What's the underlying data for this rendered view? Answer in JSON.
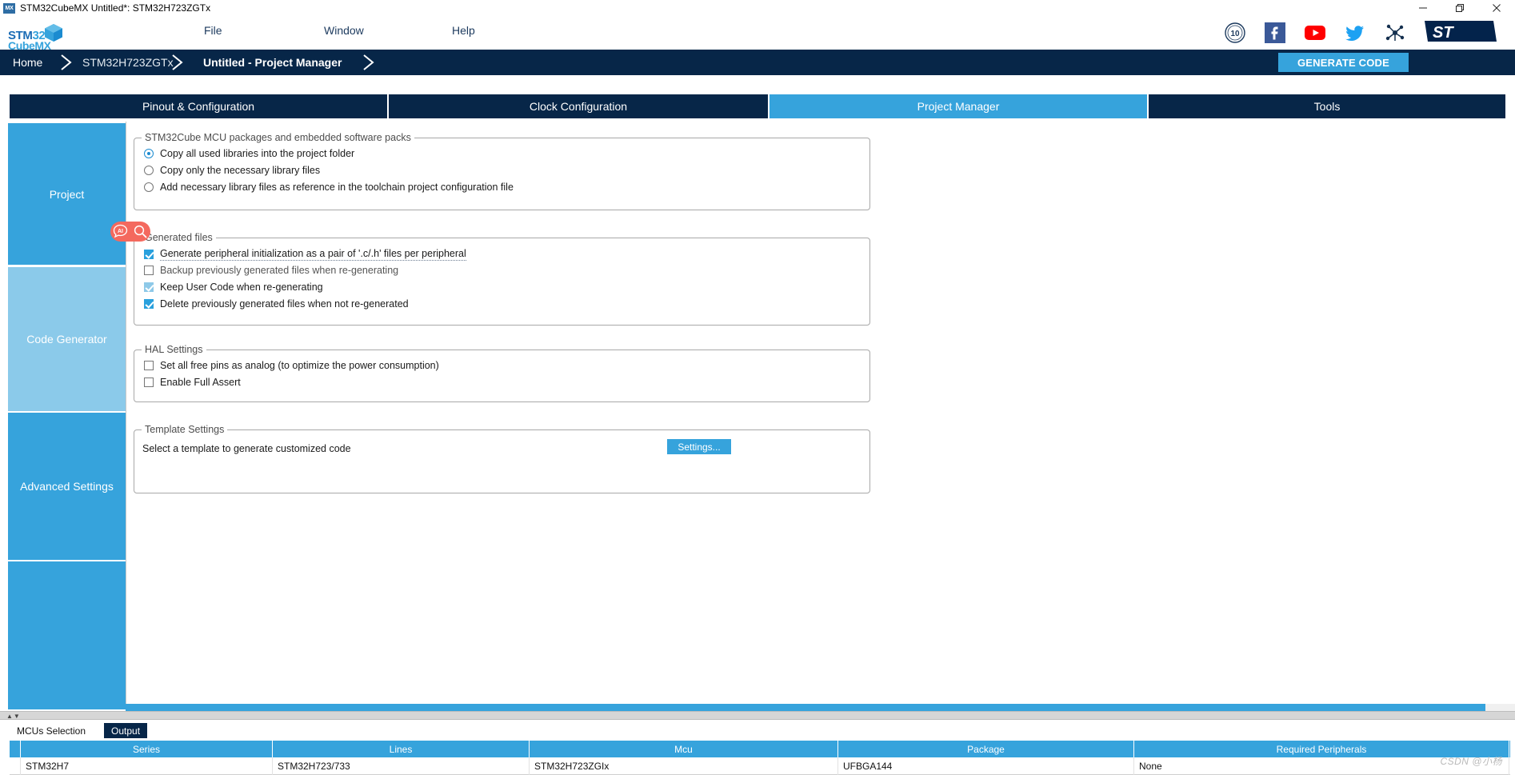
{
  "window": {
    "title": "STM32CubeMX Untitled*: STM32H723ZGTx",
    "app_icon": "mx-icon",
    "minimize_icon": "minimize-icon",
    "restore_icon": "restore-icon",
    "close_icon": "close-icon"
  },
  "logo": {
    "line1_a": "STM32",
    "line1_b": "32",
    "line2": "CubeMX",
    "cube_icon": "cube-icon"
  },
  "menu": {
    "items": [
      {
        "label": "File"
      },
      {
        "label": "Window"
      },
      {
        "label": "Help"
      }
    ]
  },
  "social": {
    "items": [
      {
        "name": "anniversary-10-years-icon"
      },
      {
        "name": "facebook-icon"
      },
      {
        "name": "youtube-icon"
      },
      {
        "name": "twitter-icon"
      },
      {
        "name": "community-network-icon"
      },
      {
        "name": "st-logo-icon"
      }
    ]
  },
  "breadcrumb": {
    "items": [
      {
        "label": "Home",
        "active": false
      },
      {
        "label": "STM32H723ZGTx",
        "active": false
      },
      {
        "label": "Untitled - Project Manager",
        "active": true
      }
    ]
  },
  "actions": {
    "generate_code": "GENERATE CODE"
  },
  "tabs": [
    {
      "label": "Pinout & Configuration",
      "selected": false
    },
    {
      "label": "Clock Configuration",
      "selected": false
    },
    {
      "label": "Project Manager",
      "selected": true
    },
    {
      "label": "Tools",
      "selected": false
    }
  ],
  "sidebar": {
    "items": [
      {
        "label": "Project",
        "selected": false
      },
      {
        "label": "Code Generator",
        "selected": true
      },
      {
        "label": "Advanced Settings",
        "selected": false
      }
    ]
  },
  "groups": {
    "packages": {
      "title": "STM32Cube MCU packages and embedded software packs",
      "options": [
        {
          "label": "Copy all used libraries into the project folder",
          "checked": true
        },
        {
          "label": "Copy only the necessary library files",
          "checked": false
        },
        {
          "label": "Add necessary library files as reference in the toolchain project configuration file",
          "checked": false
        }
      ]
    },
    "generated_files": {
      "title": "Generated files",
      "options": [
        {
          "label": "Generate peripheral initialization as a pair of '.c/.h' files per peripheral",
          "checked": true,
          "underlined": true
        },
        {
          "label": "Backup previously generated files when re-generating",
          "checked": false,
          "underlined": false
        },
        {
          "label": "Keep User Code when re-generating",
          "checked": true,
          "underlined": false
        },
        {
          "label": "Delete previously generated files when not re-generated",
          "checked": true,
          "underlined": false
        }
      ]
    },
    "hal_settings": {
      "title": "HAL Settings",
      "options": [
        {
          "label": "Set all free pins as analog (to optimize the power consumption)",
          "checked": false
        },
        {
          "label": "Enable Full Assert",
          "checked": false
        }
      ]
    },
    "template_settings": {
      "title": "Template Settings",
      "description": "Select a template to generate customized code",
      "settings_button": "Settings..."
    }
  },
  "annotation": {
    "ai_icon": "ai-chat-icon",
    "search_icon": "magnifier-icon",
    "accent_color": "#f4695e"
  },
  "bottom_tabs": [
    {
      "label": "MCUs Selection",
      "selected": false
    },
    {
      "label": "Output",
      "selected": true
    }
  ],
  "mcu_table": {
    "headers": [
      "",
      "Series",
      "Lines",
      "Mcu",
      "Package",
      "Required Peripherals"
    ],
    "rows": [
      [
        "",
        "STM32H7",
        "STM32H723/733",
        "STM32H723ZGIx",
        "UFBGA144",
        "None"
      ]
    ]
  },
  "watermark": "CSDN @小杨",
  "colors": {
    "brand_blue": "#36a3dc",
    "dark_navy": "#072648",
    "selected_sidebar": "#8bcaea",
    "annotation": "#f4695e"
  }
}
